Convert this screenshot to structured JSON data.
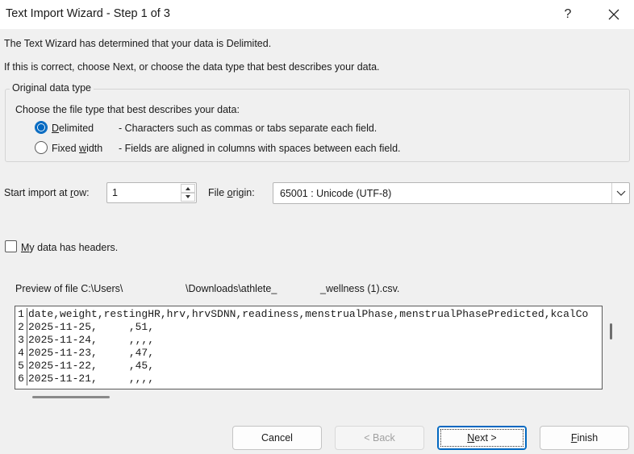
{
  "window": {
    "title": "Text Import Wizard - Step 1 of 3",
    "help_label": "?"
  },
  "intro": {
    "line1": "The Text Wizard has determined that your data is Delimited.",
    "line2": "If this is correct, choose Next, or choose the data type that best describes your data."
  },
  "original_data_type": {
    "legend": "Original data type",
    "prompt": "Choose the file type that best describes your data:",
    "options": [
      {
        "label_pre": "",
        "label_accel": "D",
        "label_post": "elimited",
        "description": "- Characters such as commas or tabs separate each field.",
        "selected": true
      },
      {
        "label_pre": "Fixed ",
        "label_accel": "w",
        "label_post": "idth",
        "description": "- Fields are aligned in columns with spaces between each field.",
        "selected": false
      }
    ]
  },
  "start_import": {
    "label_pre": "Start import at ",
    "label_accel": "r",
    "label_post": "ow:",
    "value": "1"
  },
  "file_origin": {
    "label_pre": "File ",
    "label_accel": "o",
    "label_post": "rigin:",
    "value": "65001 : Unicode (UTF-8)"
  },
  "headers_checkbox": {
    "label_accel": "M",
    "label_post": "y data has headers.",
    "checked": false
  },
  "preview": {
    "label_part1": "Preview of file C:\\Users\\",
    "label_part2": "\\Downloads\\athlete_",
    "label_part3": "_wellness (1).csv.",
    "rows": [
      {
        "num": "1",
        "text": "date,weight,restingHR,hrv,hrvSDNN,readiness,menstrualPhase,menstrualPhasePredicted,kcalCo"
      },
      {
        "num": "2",
        "text": "2025-11-25,     ,51,"
      },
      {
        "num": "3",
        "text": "2025-11-24,     ,,,,"
      },
      {
        "num": "4",
        "text": "2025-11-23,     ,47,"
      },
      {
        "num": "5",
        "text": "2025-11-22,     ,45,"
      },
      {
        "num": "6",
        "text": "2025-11-21,     ,,,,"
      }
    ]
  },
  "buttons": {
    "cancel": "Cancel",
    "back": "< Back",
    "next_accel": "N",
    "next_post": "ext >",
    "finish_accel": "F",
    "finish_post": "inish"
  },
  "colors": {
    "accent": "#0067c0",
    "background": "#f0f0f0"
  },
  "icons": {
    "close": "close-icon",
    "spin_up": "triangle-up-icon",
    "spin_down": "triangle-down-icon",
    "dropdown": "chevron-down-icon"
  }
}
